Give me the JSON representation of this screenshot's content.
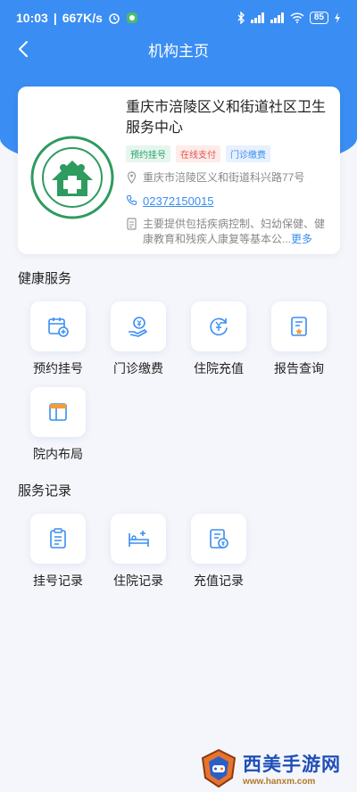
{
  "status_bar": {
    "time": "10:03",
    "speed": "667K/s",
    "battery": "85"
  },
  "navbar": {
    "title": "机构主页"
  },
  "org": {
    "name": "重庆市涪陵区义和街道社区卫生服务中心",
    "tags": [
      "预约挂号",
      "在线支付",
      "门诊缴费"
    ],
    "address": "重庆市涪陵区义和街道科兴路77号",
    "phone": "02372150015",
    "description": "主要提供包括疾病控制、妇幼保健、健康教育和残疾人康复等基本公...",
    "more_label": "更多"
  },
  "health_services": {
    "title": "健康服务",
    "items": [
      {
        "label": "预约挂号",
        "icon": "calendar-add-icon"
      },
      {
        "label": "门诊缴费",
        "icon": "hand-yen-icon"
      },
      {
        "label": "住院充值",
        "icon": "yen-refresh-icon"
      },
      {
        "label": "报告查询",
        "icon": "report-icon"
      },
      {
        "label": "院内布局",
        "icon": "layout-icon"
      }
    ]
  },
  "service_records": {
    "title": "服务记录",
    "items": [
      {
        "label": "挂号记录",
        "icon": "clipboard-icon"
      },
      {
        "label": "住院记录",
        "icon": "hospital-bed-icon"
      },
      {
        "label": "充值记录",
        "icon": "recharge-doc-icon"
      }
    ]
  },
  "watermark": {
    "title": "西美手游网",
    "url": "www.hanxm.com"
  },
  "colors": {
    "primary": "#3a8df2",
    "background": "#f4f6fb"
  }
}
